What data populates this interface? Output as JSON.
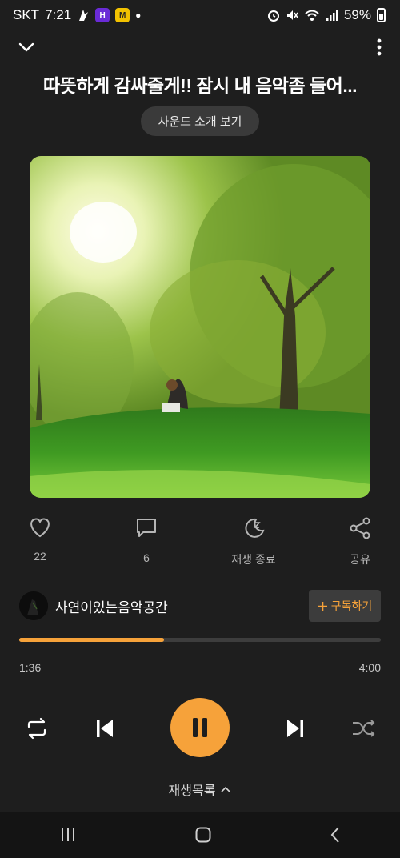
{
  "status_bar": {
    "carrier": "SKT",
    "time": "7:21",
    "battery": "59%",
    "app_icon_1": "H",
    "app_icon_2": "M"
  },
  "player": {
    "title": "따뜻하게 감싸줄게!! 잠시 내 음악좀 들어...",
    "intro_button": "사운드 소개 보기",
    "artwork_alt": "album-artwork"
  },
  "actions": {
    "like_count": "22",
    "comment_count": "6",
    "sleep_label": "재생 종료",
    "share_label": "공유"
  },
  "channel": {
    "name": "사연이있는음악공간",
    "subscribe_label": "구독하기"
  },
  "progress": {
    "current_time": "1:36",
    "total_time": "4:00",
    "fraction": 0.4
  },
  "playlist": {
    "label": "재생목록"
  },
  "colors": {
    "accent": "#f6a23a",
    "background": "#1e1e1e"
  },
  "icons": {
    "repeat": "repeat-icon",
    "previous": "previous-icon",
    "pause": "pause-icon",
    "next": "next-icon",
    "shuffle": "shuffle-icon"
  }
}
